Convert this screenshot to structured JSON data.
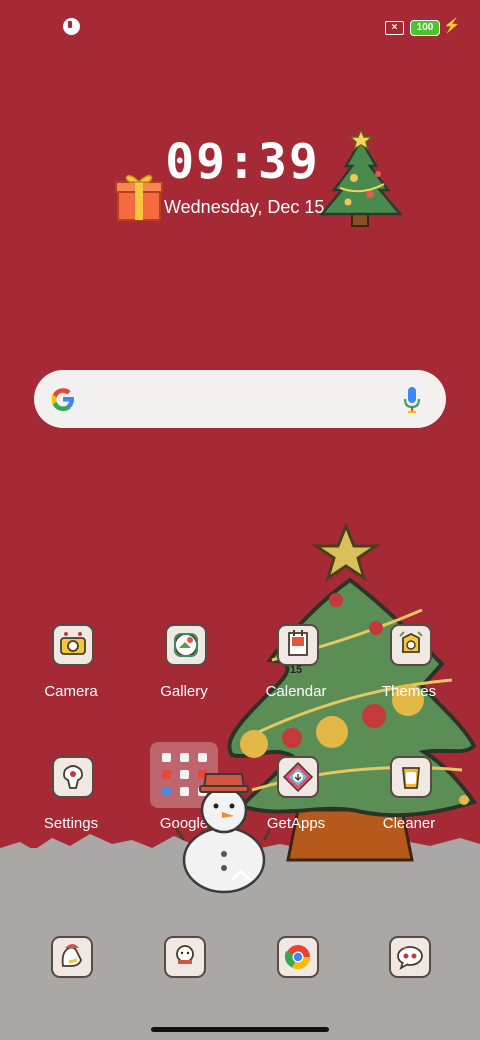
{
  "status_bar": {
    "battery_level": "100",
    "icons": [
      "app-notification-icon",
      "sim-off-icon",
      "battery-icon",
      "charging-bolt-icon"
    ]
  },
  "clock_widget": {
    "time": "09:39",
    "date": "Wednesday, Dec 15"
  },
  "search_bar": {
    "icons": [
      "google-g-icon",
      "microphone-icon"
    ]
  },
  "apps": [
    {
      "label": "Camera",
      "icon": "camera-icon"
    },
    {
      "label": "Gallery",
      "icon": "gallery-icon"
    },
    {
      "label": "Calendar",
      "icon": "calendar-icon",
      "badge": "15"
    },
    {
      "label": "Themes",
      "icon": "themes-icon"
    },
    {
      "label": "Settings",
      "icon": "settings-icon"
    },
    {
      "label": "Google",
      "icon": "google-folder-icon"
    },
    {
      "label": "GetApps",
      "icon": "getapps-icon"
    },
    {
      "label": "Cleaner",
      "icon": "cleaner-icon"
    }
  ],
  "dock": [
    "messaging-icon",
    "snowman-app-icon",
    "chrome-icon",
    "chat-bubble-icon"
  ],
  "colors": {
    "wallpaper_red": "#a52a35",
    "snow_gray": "#a9a8a7",
    "battery_green": "#52c12d"
  }
}
